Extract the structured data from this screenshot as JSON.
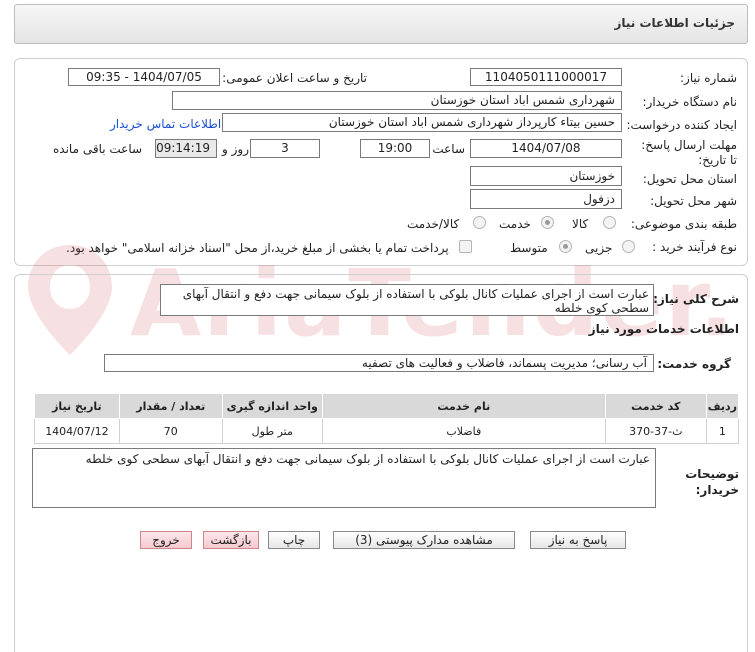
{
  "header": {
    "title": "جزئیات اطلاعات نیاز"
  },
  "form": {
    "need_number_label": "شماره نیاز:",
    "need_number": "1104050111000017",
    "announce_label": "تاریخ و ساعت اعلان عمومی:",
    "announce_value": "1404/07/05 - 09:35",
    "buyer_org_label": "نام دستگاه خریدار:",
    "buyer_org": "شهرداری شمس اباد استان خوزستان",
    "creator_label": "ایجاد کننده درخواست:",
    "creator": "حسین بیتاء کارپرداز شهرداری شمس اباد استان خوزستان",
    "contact_link": "اطلاعات تماس خریدار",
    "deadline_label": "مهلت ارسال پاسخ: تا تاریخ:",
    "deadline_date": "1404/07/08",
    "time_label": "ساعت",
    "deadline_time": "19:00",
    "days_value": "3",
    "days_label": "روز و",
    "remaining_time": "09:14:19",
    "remaining_label": "ساعت باقی مانده",
    "province_label": "استان محل تحویل:",
    "province": "خوزستان",
    "city_label": "شهر محل تحویل:",
    "city": "دزفول",
    "category_label": "طبقه بندی موضوعی:",
    "category_options": [
      "کالا",
      "خدمت",
      "کالا/خدمت"
    ],
    "process_label": "نوع فرآیند خرید :",
    "process_options": [
      "جزیی",
      "متوسط"
    ],
    "payment_note": "پرداخت تمام یا بخشی از مبلغ خرید،از محل \"اسناد خزانه اسلامی\" خواهد بود."
  },
  "summary": {
    "label": "شرح کلی نیاز:",
    "text": "عبارت است از اجرای عملیات کانال بلوکی با استفاده از بلوک سیمانی جهت دفع و انتقال آبهای سطحی کوی خلطه"
  },
  "services": {
    "section_title": "اطلاعات خدمات مورد نیاز",
    "group_label": "گروه خدمت:",
    "group_value": "آب رسانی؛ مدیریت پسماند، فاضلاب و فعالیت های تصفیه",
    "table": {
      "headers": [
        "ردیف",
        "کد خدمت",
        "نام خدمت",
        "واحد اندازه گیری",
        "تعداد / مقدار",
        "تاریخ نیاز"
      ],
      "rows": [
        [
          "1",
          "ث-37-370",
          "فاضلاب",
          "متر طول",
          "70",
          "1404/07/12"
        ]
      ]
    }
  },
  "buyer_notes": {
    "label": "توضیحات خریدار:",
    "text": "عبارت است از اجرای عملیات کانال بلوکی با استفاده از بلوک سیمانی جهت دفع و انتقال آبهای سطحی کوی خلطه"
  },
  "buttons": {
    "reply": "پاسخ به نیاز",
    "docs": "مشاهده مدارک پیوستی (3)",
    "print": "چاپ",
    "back": "بازگشت",
    "exit": "خروج"
  },
  "watermark": {
    "text": "AriaTender.net"
  },
  "colors": {
    "link": "#1a4fd6",
    "table_header": "#d9d9d9",
    "watermark": "#d0454f"
  }
}
